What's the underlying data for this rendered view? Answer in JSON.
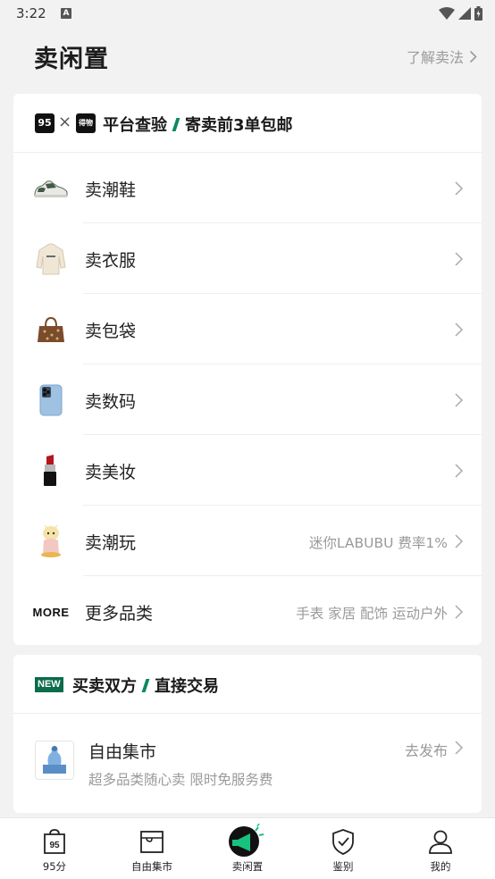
{
  "status_bar": {
    "time": "3:22",
    "notif_letter": "A"
  },
  "header": {
    "title": "卖闲置",
    "learn_link": "了解卖法"
  },
  "promo": {
    "logo_left": "95",
    "logo_right": "得物",
    "text_a": "平台查验",
    "text_b": "寄卖前3单包邮"
  },
  "categories": [
    {
      "label": "卖潮鞋",
      "extra": "",
      "icon": "sneaker-icon"
    },
    {
      "label": "卖衣服",
      "extra": "",
      "icon": "hoodie-icon"
    },
    {
      "label": "卖包袋",
      "extra": "",
      "icon": "handbag-icon"
    },
    {
      "label": "卖数码",
      "extra": "",
      "icon": "phone-icon"
    },
    {
      "label": "卖美妆",
      "extra": "",
      "icon": "lipstick-icon"
    },
    {
      "label": "卖潮玩",
      "extra": "迷你LABUBU 费率1%",
      "icon": "toy-icon"
    },
    {
      "label": "更多品类",
      "extra": "手表  家居  配饰  运动户外",
      "icon": "more-logo",
      "logo_text": "MORE"
    }
  ],
  "new_section": {
    "badge": "NEW",
    "text_a": "买卖双方",
    "text_b": "直接交易",
    "market": {
      "title": "自由集市",
      "subtitle": "超多品类随心卖 限时免服务费",
      "link": "去发布",
      "icon": "sculpture-icon"
    }
  },
  "tabbar": [
    {
      "label": "95分",
      "icon": "bag-95-icon",
      "active": false
    },
    {
      "label": "自由集市",
      "icon": "market-icon",
      "active": false
    },
    {
      "label": "卖闲置",
      "icon": "megaphone-icon",
      "active": true
    },
    {
      "label": "鉴别",
      "icon": "shield-check-icon",
      "active": false
    },
    {
      "label": "我的",
      "icon": "user-icon",
      "active": false
    }
  ],
  "colors": {
    "accent": "#0b8a5c",
    "background": "#f2f2f2",
    "muted_text": "#9a9a9a"
  }
}
